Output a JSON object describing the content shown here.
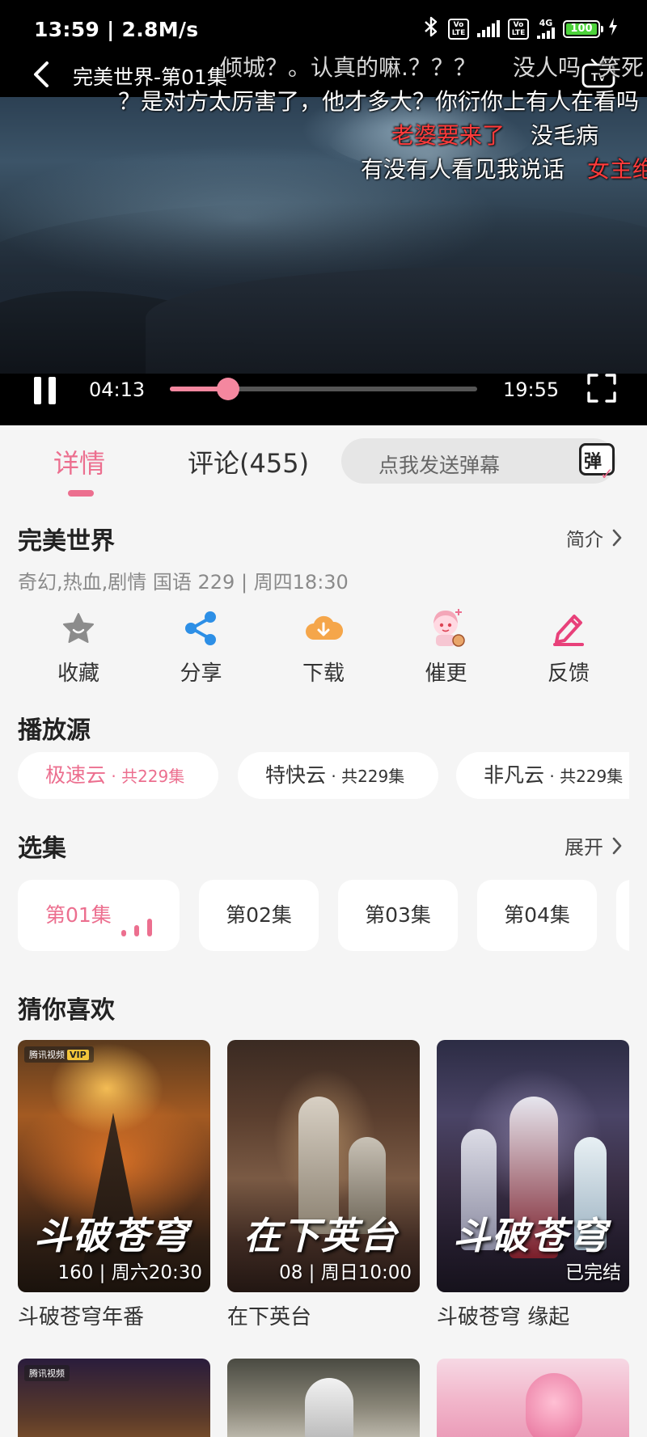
{
  "status_bar": {
    "time": "13:59 | 2.8M/s",
    "lte1": "Vo LTE",
    "lte2": "Vo LTE",
    "net": "4G",
    "battery": "100"
  },
  "player": {
    "title": "完美世界-第01集",
    "current_time": "04:13",
    "duration": "19:55",
    "progress_fraction": 0.19,
    "tv_label": "TV",
    "accent_color": "#f4879f"
  },
  "danmaku": [
    {
      "text": "倾城？。认真的嘛.？？？",
      "color": "dim"
    },
    {
      "text": "没人吗",
      "color": "dim"
    },
    {
      "text": "笑死",
      "color": "dim"
    },
    {
      "text": "？是对方太厉害了，他才多大？你衍你上有人在看吗",
      "color": "white"
    },
    {
      "text": "老婆要来了",
      "color": "red"
    },
    {
      "text": "没毛病",
      "color": "white"
    },
    {
      "text": "有没有人看见我说话",
      "color": "white"
    },
    {
      "text": "女主绝",
      "color": "red"
    }
  ],
  "tabs": {
    "details": "详情",
    "comments": "评论(455)",
    "danmu_placeholder": "点我发送弹幕",
    "danmu_btn": "弹"
  },
  "show": {
    "title": "完美世界",
    "intro_label": "简介",
    "meta": "奇幻,热血,剧情 国语 229 | 周四18:30"
  },
  "actions": [
    {
      "label": "收藏",
      "icon": "star-icon"
    },
    {
      "label": "分享",
      "icon": "share-icon"
    },
    {
      "label": "下载",
      "icon": "download-icon"
    },
    {
      "label": "催更",
      "icon": "urge-update-icon"
    },
    {
      "label": "反馈",
      "icon": "feedback-icon"
    }
  ],
  "sources": {
    "title": "播放源",
    "items": [
      {
        "name": "极速云",
        "count": " · 共229集"
      },
      {
        "name": "特快云",
        "count": " · 共229集"
      },
      {
        "name": "非凡云",
        "count": " · 共229集"
      }
    ]
  },
  "episodes": {
    "title": "选集",
    "expand_label": "展开",
    "items": [
      "第01集",
      "第02集",
      "第03集",
      "第04集"
    ]
  },
  "recommend": {
    "title": "猜你喜欢",
    "items": [
      {
        "name": "斗破苍穹年番",
        "caption": "160 | 周六20:30",
        "badge": "腾讯视频",
        "badge_tag": "VIP",
        "poster_text": "斗破苍穹"
      },
      {
        "name": "在下英台",
        "caption": "08 | 周日10:00",
        "poster_text": "在下英台"
      },
      {
        "name": "斗破苍穹 缘起",
        "caption": "已完结",
        "poster_text": "斗破苍穹"
      }
    ],
    "row2_badge": "腾讯视频"
  },
  "colors": {
    "accent_pink": "#ec6f8f",
    "background": "#f5f5f5"
  }
}
